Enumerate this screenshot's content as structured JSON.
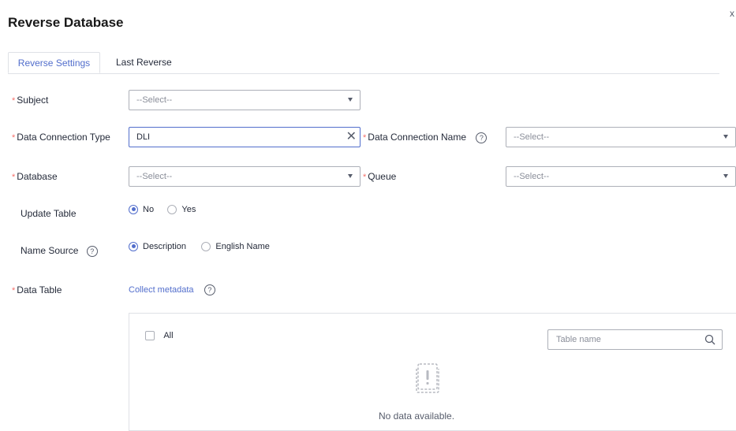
{
  "dialog": {
    "title": "Reverse Database",
    "close_glyph": "x"
  },
  "tabs": [
    {
      "label": "Reverse Settings",
      "active": true
    },
    {
      "label": "Last Reverse",
      "active": false
    }
  ],
  "form": {
    "required_mark": "*",
    "help_glyph": "?",
    "subject": {
      "label": "Subject",
      "placeholder": "--Select--"
    },
    "data_connection_type": {
      "label": "Data Connection Type",
      "value": "DLI",
      "clear_glyph": "✕"
    },
    "data_connection_name": {
      "label": "Data Connection Name",
      "placeholder": "--Select--"
    },
    "database": {
      "label": "Database",
      "placeholder": "--Select--"
    },
    "queue": {
      "label": "Queue",
      "placeholder": "--Select--"
    },
    "update_table": {
      "label": "Update Table",
      "options": [
        "No",
        "Yes"
      ],
      "selected": "No"
    },
    "name_source": {
      "label": "Name Source",
      "options": [
        "Description",
        "English Name"
      ],
      "selected": "Description"
    },
    "data_table": {
      "label": "Data Table",
      "link": "Collect metadata"
    }
  },
  "table_panel": {
    "all_label": "All",
    "search_placeholder": "Table name",
    "empty_text": "No data available."
  },
  "colors": {
    "accent": "#526ecc",
    "required": "#f66f6a",
    "border": "#adb0b8"
  },
  "icons": {
    "close": "close-icon",
    "caret": "chevron-down-icon",
    "help": "help-circle-icon",
    "search": "search-icon",
    "empty": "empty-state-icon"
  }
}
